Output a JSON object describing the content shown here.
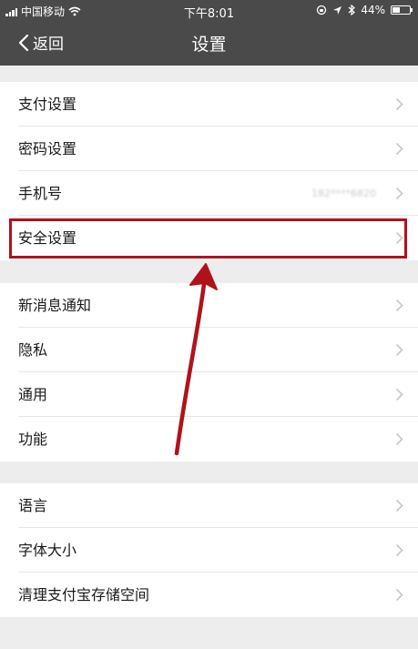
{
  "status_bar": {
    "carrier": "中国移动",
    "time": "下午8:01",
    "battery_percent": "44%",
    "battery_level": 0.44
  },
  "nav": {
    "back_label": "返回",
    "title": "设置"
  },
  "groups": [
    {
      "items": [
        {
          "label": "支付设置"
        },
        {
          "label": "密码设置"
        },
        {
          "label": "手机号",
          "value": "182****6820"
        },
        {
          "label": "安全设置"
        }
      ]
    },
    {
      "items": [
        {
          "label": "新消息通知"
        },
        {
          "label": "隐私"
        },
        {
          "label": "通用"
        },
        {
          "label": "功能"
        }
      ]
    },
    {
      "items": [
        {
          "label": "语言"
        },
        {
          "label": "字体大小"
        },
        {
          "label": "清理支付宝存储空间"
        }
      ]
    }
  ],
  "annotation": {
    "color": "#b0121b",
    "highlighted_item": "安全设置"
  }
}
